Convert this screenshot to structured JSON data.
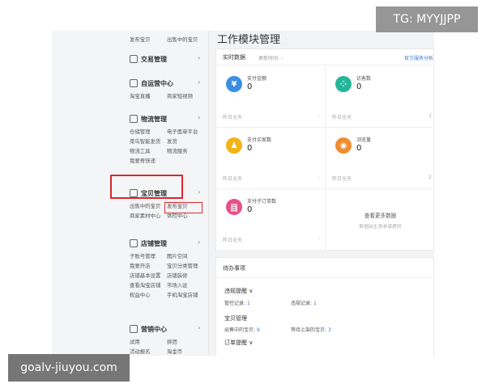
{
  "colors": {
    "accent_red": "#d9262c",
    "link_blue": "#3b73d6",
    "card_border": "#e8e8e8"
  },
  "sidebar": {
    "top_row": [
      "发布宝贝",
      "出售中的宝贝"
    ],
    "groups": [
      {
        "icon": "trade-icon",
        "title": "交易管理",
        "rows": []
      },
      {
        "icon": "chat-icon",
        "title": "自运营中心",
        "rows": [
          [
            "淘宝直播",
            "商家短视频"
          ]
        ]
      },
      {
        "icon": "truck-icon",
        "title": "物流管理",
        "rows": [
          [
            "仓储管理",
            "电子面单平台"
          ],
          [
            "菜鸟智能发货",
            "发货"
          ],
          [
            "物流工具",
            "物流服务"
          ],
          [
            "我要寄快递",
            ""
          ]
        ]
      },
      {
        "icon": "bag-icon",
        "title": "宝贝管理",
        "rows": [
          [
            "出售中的宝贝",
            "发布宝贝"
          ],
          [
            "商家素材中心",
            "体检中心"
          ]
        ]
      },
      {
        "icon": "shop-icon",
        "title": "店铺管理",
        "rows": [
          [
            "子账号管理",
            "图片空间"
          ],
          [
            "我要开店",
            "宝贝分类管理"
          ],
          [
            "店铺基本设置",
            "店铺装修"
          ],
          [
            "查看淘宝店铺",
            "市场入驻"
          ],
          [
            "权益中心",
            "手机淘宝店铺"
          ]
        ]
      },
      {
        "icon": "megaphone-icon",
        "title": "营销中心",
        "rows": [
          [
            "试用",
            "拼团"
          ],
          [
            "活动报名",
            "淘金币"
          ]
        ]
      }
    ]
  },
  "main": {
    "page_title": "工作模块管理",
    "realtime": {
      "title": "实时数据",
      "updated": "更新时间: -",
      "link": "官方服务分析",
      "metrics": [
        {
          "icon": "yuan-icon",
          "glyph": "¥",
          "color": "#3a8ee6",
          "label": "支付金额",
          "value": "0",
          "foot": "昨日全天",
          "side": "left",
          "row": 0
        },
        {
          "icon": "footprint-icon",
          "glyph": "⁘",
          "color": "#27b59a",
          "label": "访客数",
          "value": "0",
          "foot": "昨日全天",
          "foot2": "1",
          "side": "right",
          "row": 0
        },
        {
          "icon": "buyer-icon",
          "glyph": "♟",
          "color": "#f2b316",
          "label": "支付买家数",
          "value": "0",
          "foot": "昨日全天",
          "side": "left",
          "row": 1
        },
        {
          "icon": "eye-icon",
          "glyph": "◉",
          "color": "#f08c2e",
          "label": "浏览量",
          "value": "0",
          "foot": "昨日全天",
          "foot2": "2",
          "side": "right",
          "row": 1
        },
        {
          "icon": "order-icon",
          "glyph": "目",
          "color": "#e94f8a",
          "label": "支付子订单数",
          "value": "0",
          "foot": "昨日全天",
          "side": "left",
          "row": 2
        }
      ],
      "view_more": "查看更多数据",
      "view_more_sub": "数据由生意参谋提供"
    },
    "todo": {
      "title": "待办事项",
      "sections": [
        {
          "title": "违规提醒 ∨",
          "items": [
            {
              "label": "管控记录:",
              "count": "1"
            },
            {
              "label": "违规记录:",
              "count": "1"
            }
          ]
        },
        {
          "title": "宝贝管理",
          "items": [
            {
              "label": "出售中的宝贝:",
              "count": "9"
            },
            {
              "label": "等待上架的宝贝:",
              "count": "3"
            }
          ]
        },
        {
          "title": "订单提醒 ∨",
          "items": []
        }
      ]
    }
  },
  "overlays": {
    "tg": "TG: MYYJJPP",
    "site": "goalv-jiuyou.com"
  }
}
